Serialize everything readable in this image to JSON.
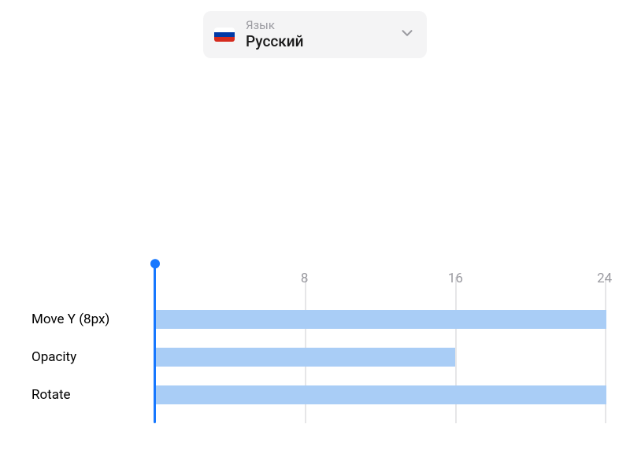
{
  "language_selector": {
    "label": "Язык",
    "value": "Русский"
  },
  "timeline": {
    "ticks": [
      "8",
      "16",
      "24"
    ],
    "rows": [
      {
        "label": "Move Y (8px)"
      },
      {
        "label": "Opacity"
      },
      {
        "label": "Rotate"
      }
    ]
  },
  "chart_data": {
    "type": "bar",
    "title": "",
    "xlabel": "",
    "ylabel": "",
    "xlim": [
      0,
      24
    ],
    "categories": [
      "Move Y (8px)",
      "Opacity",
      "Rotate"
    ],
    "series": [
      {
        "name": "duration",
        "values": [
          24,
          16,
          24
        ]
      }
    ],
    "playhead": 0
  }
}
